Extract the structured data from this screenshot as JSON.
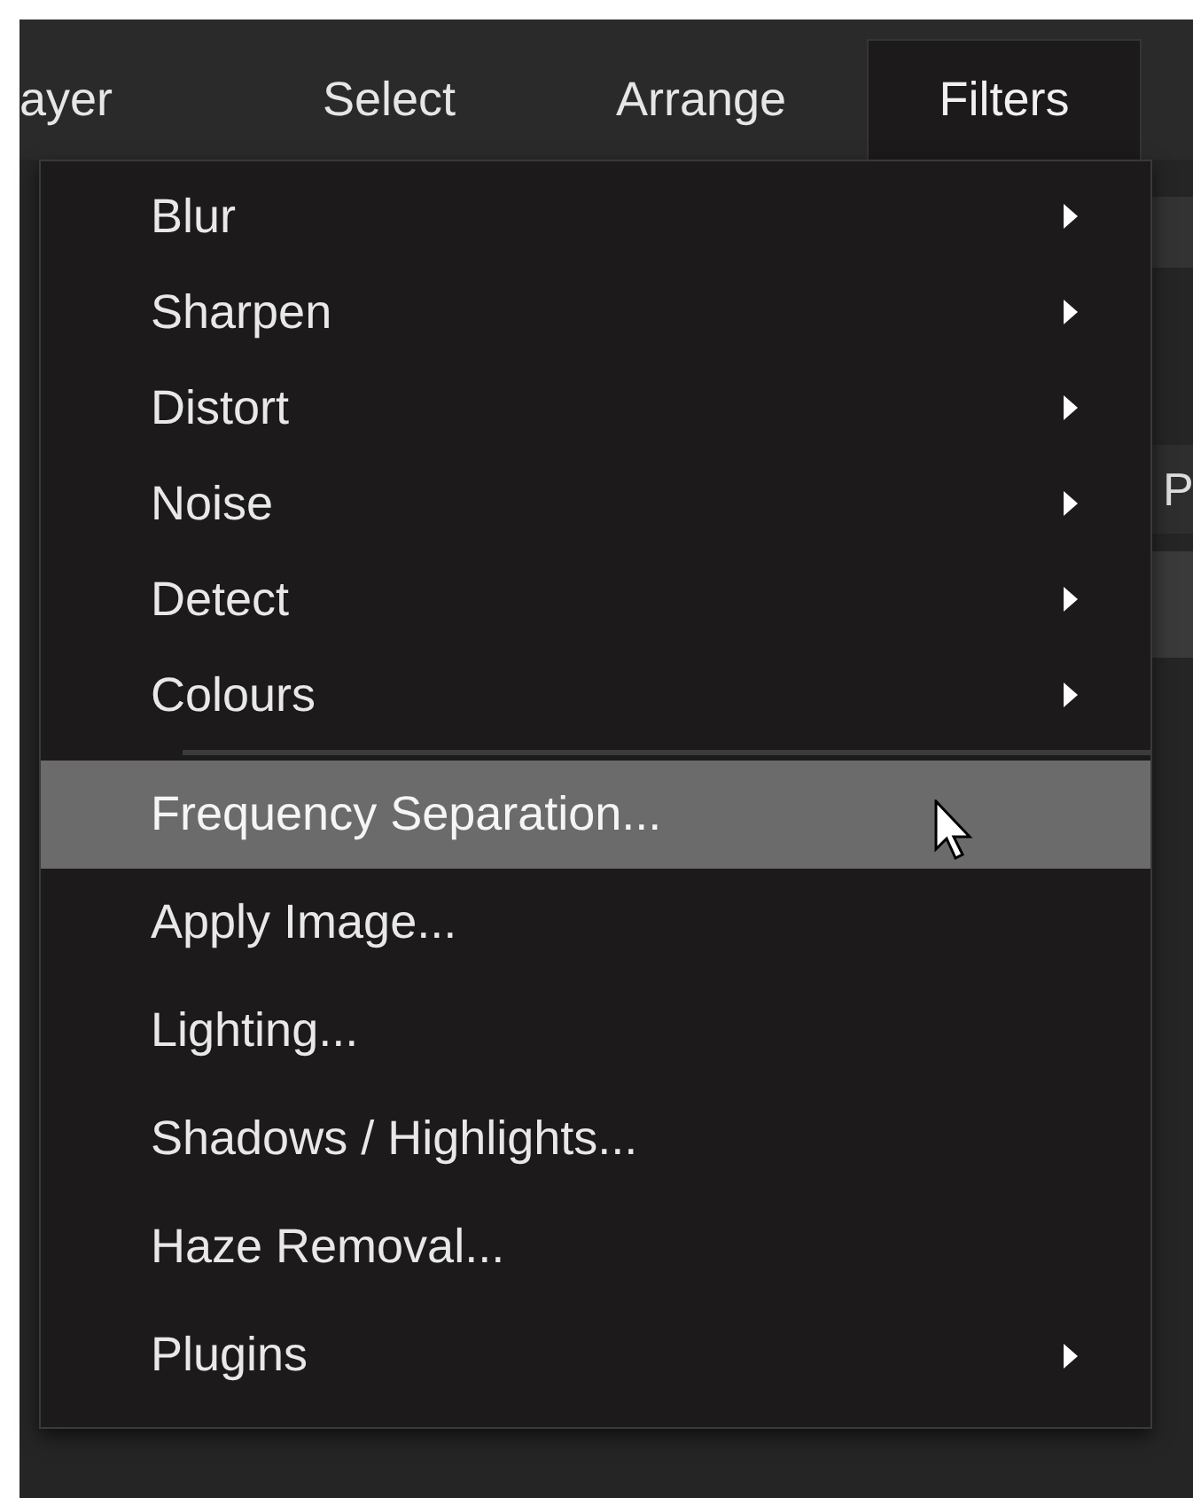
{
  "menu_bar": [
    {
      "label": "ayer",
      "selected": false
    },
    {
      "label": "Select",
      "selected": false
    },
    {
      "label": "Arrange",
      "selected": false
    },
    {
      "label": "Filters",
      "selected": true
    }
  ],
  "background_text": "P",
  "menu": [
    {
      "label": "Blur",
      "submenu": true,
      "selected": false
    },
    {
      "label": "Sharpen",
      "submenu": true,
      "selected": false
    },
    {
      "label": "Distort",
      "submenu": true,
      "selected": false
    },
    {
      "label": "Noise",
      "submenu": true,
      "selected": false
    },
    {
      "label": "Detect",
      "submenu": true,
      "selected": false
    },
    {
      "label": "Colours",
      "submenu": true,
      "selected": false
    },
    {
      "kind": "separator"
    },
    {
      "label": "Frequency Separation...",
      "submenu": false,
      "selected": true
    },
    {
      "label": "Apply Image...",
      "submenu": false,
      "selected": false
    },
    {
      "label": "Lighting...",
      "submenu": false,
      "selected": false
    },
    {
      "label": "Shadows / Highlights...",
      "submenu": false,
      "selected": false
    },
    {
      "label": "Haze Removal...",
      "submenu": false,
      "selected": false
    },
    {
      "label": "Plugins",
      "submenu": true,
      "selected": false
    }
  ]
}
